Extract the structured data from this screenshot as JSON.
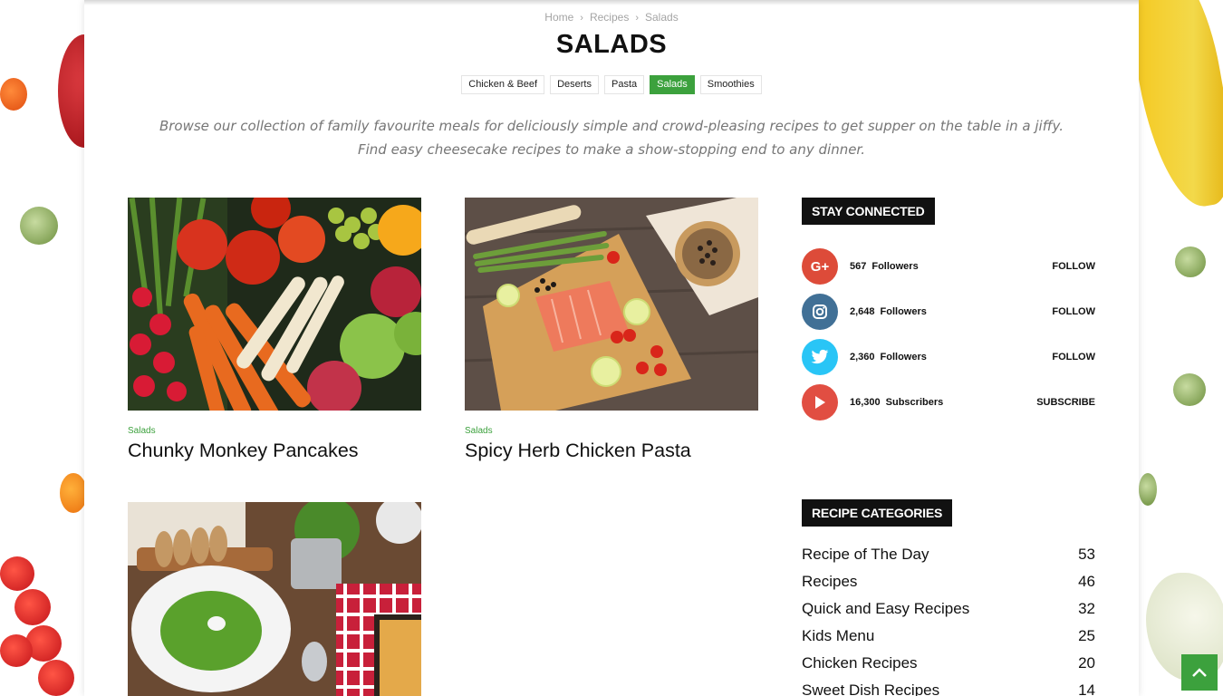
{
  "breadcrumb": {
    "home": "Home",
    "recipes": "Recipes",
    "current": "Salads",
    "separator": "›"
  },
  "page_title": "SALADS",
  "category_tabs": [
    {
      "label": "Chicken & Beef",
      "active": false
    },
    {
      "label": "Deserts",
      "active": false
    },
    {
      "label": "Pasta",
      "active": false
    },
    {
      "label": "Salads",
      "active": true
    },
    {
      "label": "Smoothies",
      "active": false
    }
  ],
  "intro": {
    "line1": "Browse our collection of family favourite meals for deliciously simple and crowd-pleasing recipes to get supper on the table in a jiffy.",
    "line2": "Find easy cheesecake recipes to make a show-stopping end to any dinner."
  },
  "posts": [
    {
      "category": "Salads",
      "title": "Chunky Monkey Pancakes",
      "image": "vegetables-photo"
    },
    {
      "category": "Salads",
      "title": "Spicy Herb Chicken Pasta",
      "image": "salmon-board-photo"
    },
    {
      "category": "",
      "title": "",
      "image": "green-soup-photo"
    }
  ],
  "sidebar": {
    "stay_connected_title": "STAY CONNECTED",
    "social": [
      {
        "network": "google-plus",
        "icon": "google-plus-icon",
        "glyph": "G+",
        "color": "#dd4b39",
        "count": "567",
        "unit": "Followers",
        "action": "FOLLOW"
      },
      {
        "network": "instagram",
        "icon": "instagram-icon",
        "glyph": "",
        "color": "#417096",
        "count": "2,648",
        "unit": "Followers",
        "action": "FOLLOW"
      },
      {
        "network": "twitter",
        "icon": "twitter-icon",
        "glyph": "",
        "color": "#29c5f6",
        "count": "2,360",
        "unit": "Followers",
        "action": "FOLLOW"
      },
      {
        "network": "youtube",
        "icon": "youtube-icon",
        "glyph": "",
        "color": "#e14e42",
        "count": "16,300",
        "unit": "Subscribers",
        "action": "SUBSCRIBE"
      }
    ],
    "recipe_categories_title": "RECIPE CATEGORIES",
    "recipe_categories": [
      {
        "name": "Recipe of The Day",
        "count": "53"
      },
      {
        "name": "Recipes",
        "count": "46"
      },
      {
        "name": "Quick and Easy Recipes",
        "count": "32"
      },
      {
        "name": "Kids Menu",
        "count": "25"
      },
      {
        "name": "Chicken Recipes",
        "count": "20"
      },
      {
        "name": "Sweet Dish Recipes",
        "count": "14"
      }
    ]
  },
  "colors": {
    "accent": "#3ca13d",
    "text": "#111111",
    "muted": "#767676"
  },
  "back_to_top_icon": "chevron-up-icon"
}
